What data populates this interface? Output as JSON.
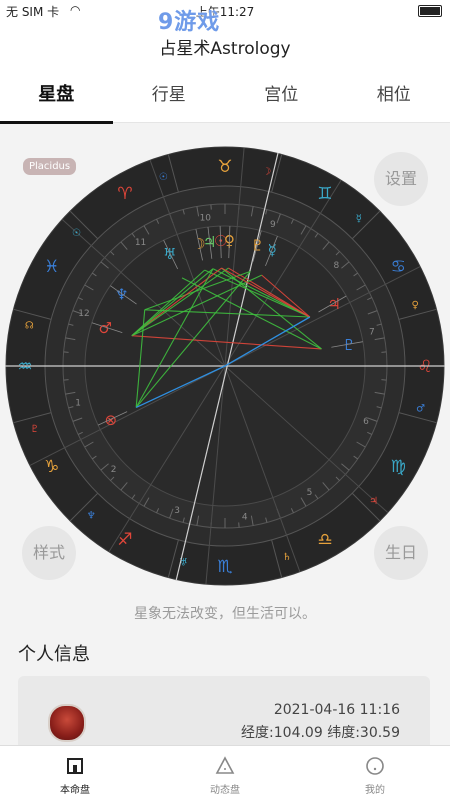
{
  "status_bar": {
    "carrier": "无 SIM 卡",
    "time": "上午11:27"
  },
  "watermark": "9游戏",
  "navbar": {
    "title": "占星术Astrology"
  },
  "tabs": [
    {
      "label": "星盘",
      "active": true
    },
    {
      "label": "行星",
      "active": false
    },
    {
      "label": "宫位",
      "active": false
    },
    {
      "label": "相位",
      "active": false
    }
  ],
  "chart": {
    "house_system": "Placidus",
    "settings_label": "设置",
    "style_label": "样式",
    "birthday_label": "生日",
    "house_numbers": [
      "1",
      "2",
      "3",
      "4",
      "5",
      "6",
      "7",
      "8",
      "9",
      "10",
      "11",
      "12"
    ],
    "signs": [
      "♈",
      "♉",
      "♊",
      "♋",
      "♌",
      "♍",
      "♎",
      "♏",
      "♐",
      "♑",
      "♒",
      "♓"
    ],
    "sign_colors": [
      "#e0463a",
      "#e6a23c",
      "#3aa8c8",
      "#3a7fd8",
      "#e0463a",
      "#3aa8c8",
      "#e6a23c",
      "#3a7fd8",
      "#e0463a",
      "#e6a23c",
      "#3aa8c8",
      "#3a7fd8"
    ],
    "planet_glyphs": [
      "☉",
      "☽",
      "☿",
      "♀",
      "♂",
      "♃",
      "♄",
      "♅",
      "♆",
      "♇",
      "☊"
    ]
  },
  "motto": "星象无法改变，但生活可以。",
  "personal_info": {
    "title": "个人信息",
    "datetime": "2021-04-16 11:16",
    "coords": "经度:104.09 纬度:30.59"
  },
  "bottom_nav": [
    {
      "label": "本命盘",
      "icon": "home-chart-icon",
      "active": true
    },
    {
      "label": "动态盘",
      "icon": "triangle-icon",
      "active": false
    },
    {
      "label": "我的",
      "icon": "profile-icon",
      "active": false
    }
  ]
}
